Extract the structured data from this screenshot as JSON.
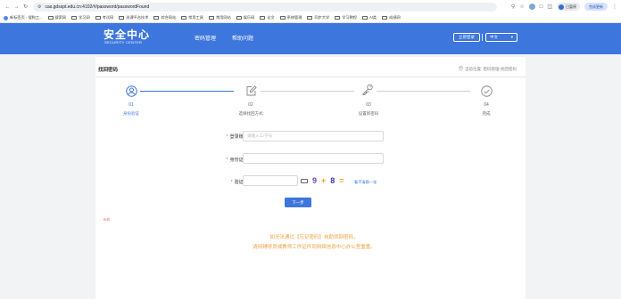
{
  "browser": {
    "url": "cas.gdsspt.edu.cn:4102/#/password/passwordFound",
    "profile_name": "已暂停",
    "sync_label": "完成更新"
  },
  "bookmarks": [
    "新标签页 - 搜狗工...",
    "搜索网",
    "学习网",
    "考试网",
    "选课平台技术",
    "综合网站",
    "常用工具",
    "常用网站",
    "娱乐网",
    "论文",
    "系统管理",
    "同步大学",
    "学习教程",
    "AI类",
    "成绩网"
  ],
  "header": {
    "logo_cn": "安全中心",
    "logo_en": "SECURITY CENTER",
    "nav": [
      "密码管理",
      "帮助问题"
    ],
    "login_button": "立即登录",
    "language": "中文"
  },
  "page": {
    "title": "找回密码",
    "location": "当前位置: 密码管理-找回密码"
  },
  "steps": [
    {
      "num": "01",
      "label": "身份验证",
      "active": true,
      "icon": "user-circle-icon"
    },
    {
      "num": "02",
      "label": "选择找回方式",
      "active": false,
      "icon": "edit-icon"
    },
    {
      "num": "03",
      "label": "设置新密码",
      "active": false,
      "icon": "key-icon"
    },
    {
      "num": "04",
      "label": "完成",
      "active": false,
      "icon": "check-circle-icon"
    }
  ],
  "form": {
    "account_label": "登录账号:",
    "account_placeholder": "请输入工/学号",
    "id_label": "身份证号:",
    "id_placeholder": "",
    "captcha_label": "验证码:",
    "captcha_placeholder": "",
    "captcha_chars": [
      "9",
      "+",
      "8",
      "="
    ],
    "refresh_label": "看不清换一张",
    "next_button": "下一步"
  },
  "null_text": "null",
  "notice": {
    "line1": "如无法通过【忘记密码】自助找回密码，",
    "line2": "请持辅导员或教师工作证件到网络信息中心办公室重置。"
  },
  "colors": {
    "brand": "#3d76dd",
    "warning": "#f0a040",
    "required": "#f05050"
  }
}
